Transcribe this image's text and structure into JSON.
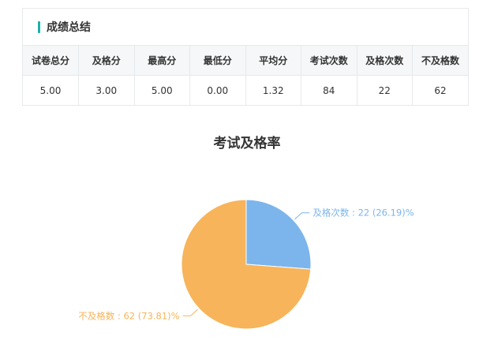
{
  "panel": {
    "title": "成绩总结",
    "accent_color": "#1ab1a8"
  },
  "table": {
    "headers": [
      "试卷总分",
      "及格分",
      "最高分",
      "最低分",
      "平均分",
      "考试次数",
      "及格次数",
      "不及格数"
    ],
    "row": [
      "5.00",
      "3.00",
      "5.00",
      "0.00",
      "1.32",
      "84",
      "22",
      "62"
    ]
  },
  "chart_data": {
    "type": "pie",
    "title": "考试及格率",
    "slices": [
      {
        "name": "及格次数",
        "value": 22,
        "percent": "26.19",
        "label": "及格次数 : 22 (26.19)%",
        "color": "#7cb5ec"
      },
      {
        "name": "不及格数",
        "value": 62,
        "percent": "73.81",
        "label": "不及格数 : 62 (73.81)%",
        "color": "#f7b45a"
      }
    ]
  }
}
